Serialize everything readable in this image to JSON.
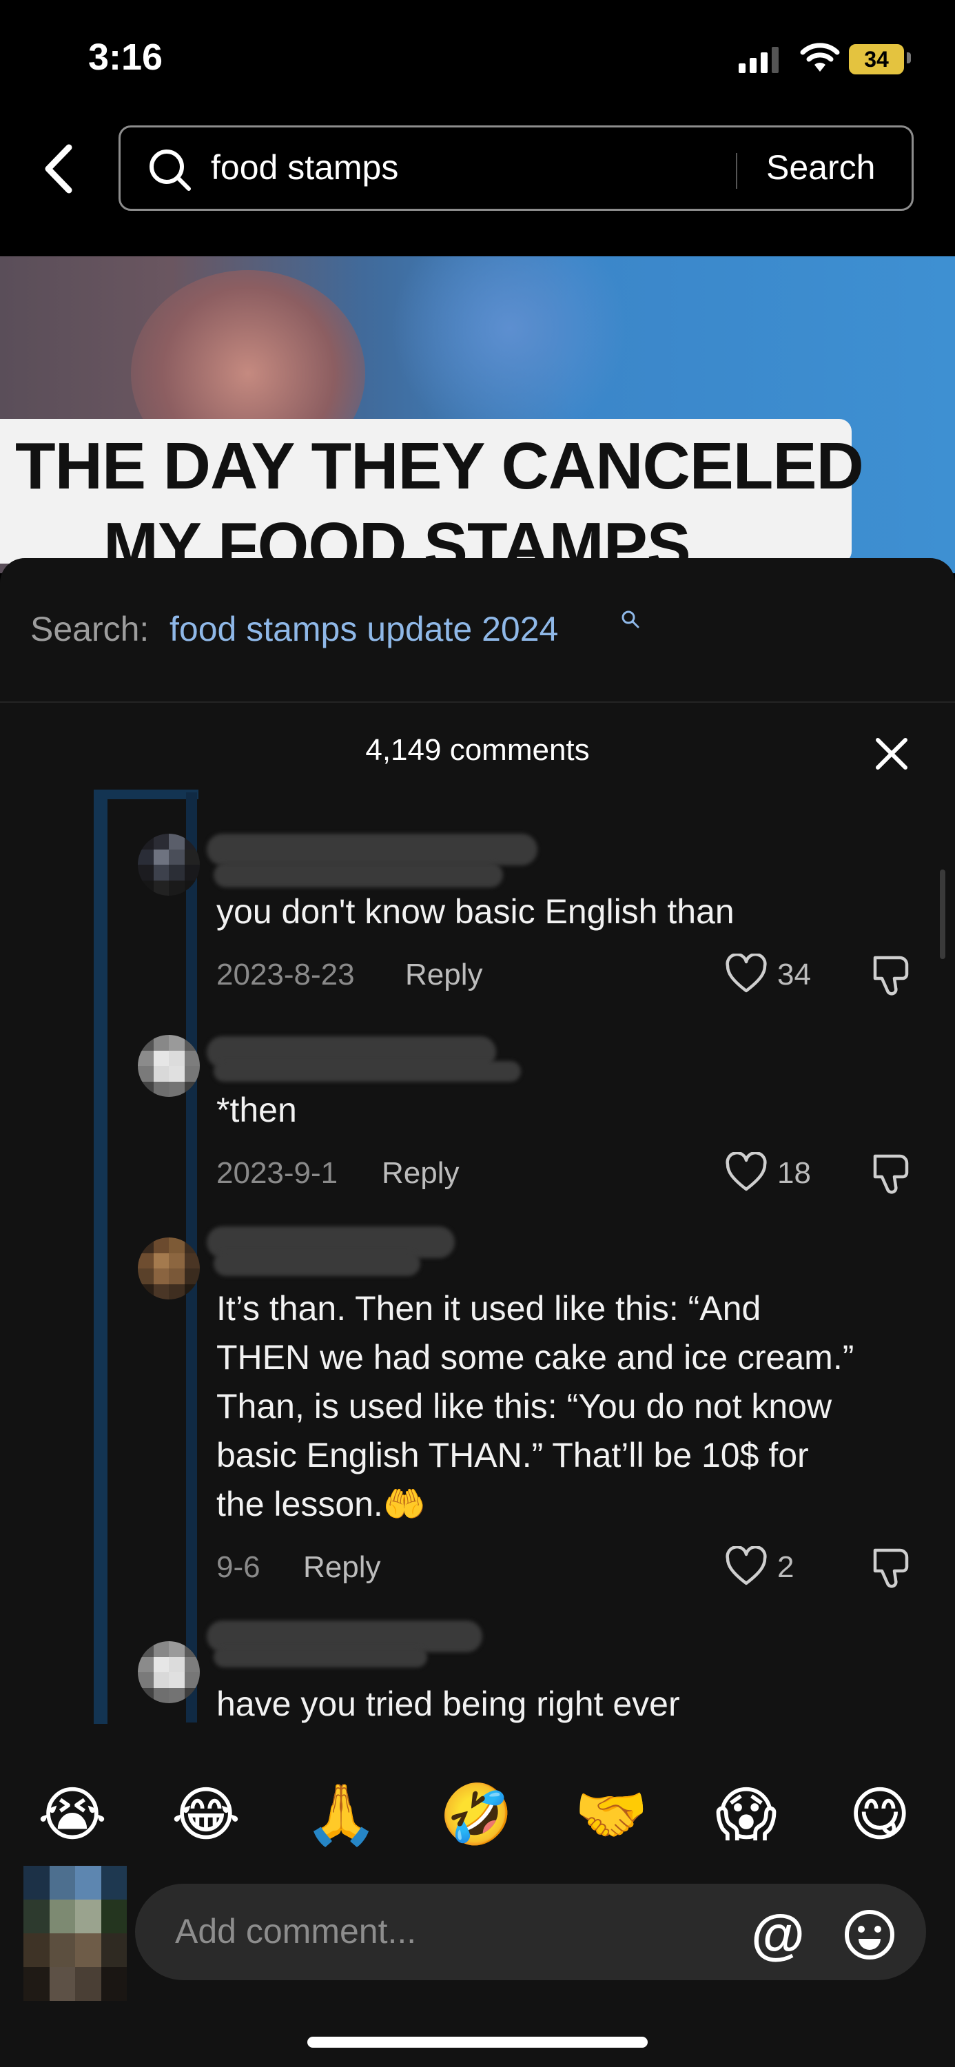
{
  "status_bar": {
    "time": "3:16",
    "battery": "34"
  },
  "search": {
    "query": "food stamps",
    "button_label": "Search"
  },
  "video": {
    "caption_line1": "THE DAY THEY CANCELED",
    "caption_line2": "MY FOOD STAMPS"
  },
  "related_search": {
    "label": "Search:",
    "query": "food stamps update 2024"
  },
  "comments_header": {
    "count_label": "4,149 comments"
  },
  "comments": [
    {
      "text": "you don't know basic English than",
      "date": "2023-8-23",
      "reply_label": "Reply",
      "likes": "34"
    },
    {
      "text": "*then",
      "date": "2023-9-1",
      "reply_label": "Reply",
      "likes": "18"
    },
    {
      "text_lines": [
        "It’s than. Then it used like this: “And",
        "THEN we had some cake and ice cream.”",
        "Than, is used like this: “You do not know",
        "basic English THAN.” That’ll be 10$ for",
        "the lesson.🤲"
      ],
      "date": "9-6",
      "reply_label": "Reply",
      "likes": "2"
    },
    {
      "text": "have you tried being right ever"
    }
  ],
  "emoji_bar": [
    "😭",
    "😂",
    "🙏",
    "🤣",
    "🤝",
    "😱",
    "😋"
  ],
  "composer": {
    "placeholder": "Add comment..."
  },
  "colors": {
    "accent_link": "#8fb8e8",
    "thread_line": "#133452",
    "sheet_bg": "#121212",
    "battery": "#e4c33f"
  }
}
